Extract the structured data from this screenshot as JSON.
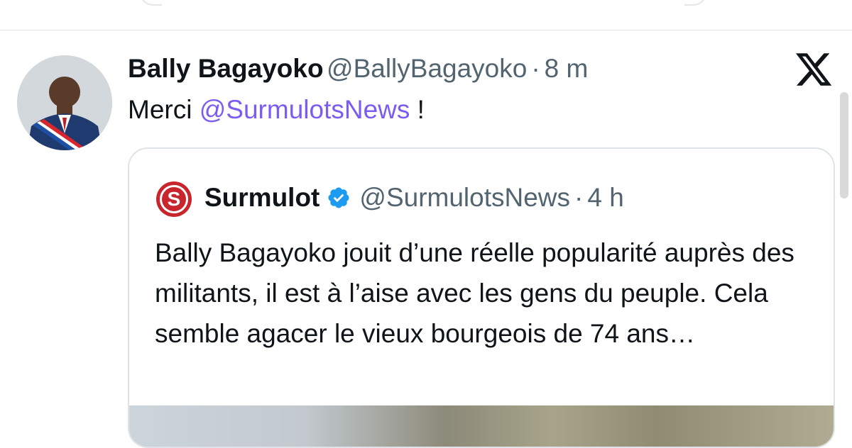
{
  "tweet": {
    "author_name": "Bally Bagayoko",
    "author_handle": "@BallyBagayoko",
    "separator": "·",
    "time": "8 m",
    "text_prefix": "Merci ",
    "mention": "@SurmulotsNews",
    "text_suffix": " !"
  },
  "quoted_tweet": {
    "logo_letter": "S",
    "author_name": "Surmulot",
    "author_handle": "@SurmulotsNews",
    "separator": "·",
    "time": "4 h",
    "text": "Bally Bagayoko jouit d’une réelle popularité auprès des militants, il est à l’aise avec les gens du peuple. Cela semble agacer le vieux bourgeois de 74 ans…"
  },
  "icons": {
    "brand": "x-logo-icon",
    "verified": "verified-badge-icon",
    "quoted_logo": "surmulot-logo-icon"
  },
  "colors": {
    "mention": "#7b5cf0",
    "verified": "#1d9bf0",
    "surmulot_red": "#c8262c",
    "secondary_text": "#536471"
  }
}
